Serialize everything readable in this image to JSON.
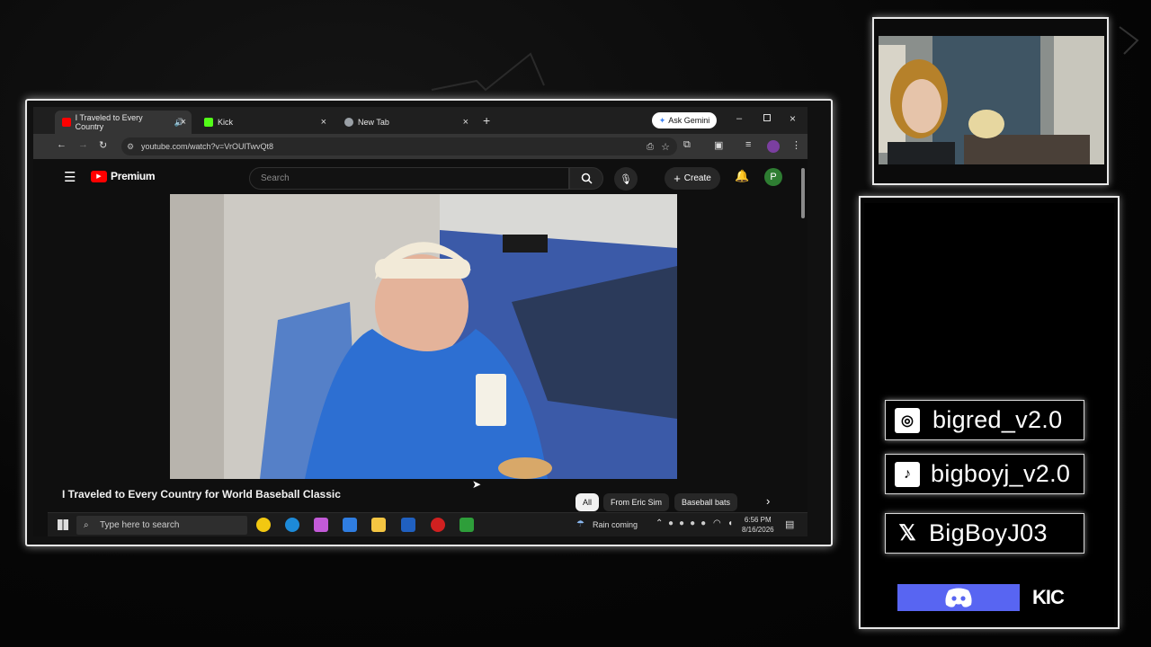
{
  "browser": {
    "tabs": [
      {
        "label": "I Traveled to Every Country",
        "favicon_color": "#ff0000",
        "active": true
      },
      {
        "label": "Kick",
        "favicon_color": "#53fc18",
        "active": false
      },
      {
        "label": "New Tab",
        "favicon_color": "#9aa0a6",
        "active": false
      }
    ],
    "new_tab_symbol": "+",
    "ask_gemini_label": "Ask Gemini",
    "url": "youtube.com/watch?v=VrOUlTwvQt8"
  },
  "youtube": {
    "brand_label": "Premium",
    "search_placeholder": "Search",
    "create_label": "Create",
    "avatar_letter": "P",
    "video_title": "I Traveled to Every Country for World Baseball Classic",
    "chips": [
      "All",
      "From Eric Sim",
      "Baseball bats"
    ],
    "channel_partial": "Eric Sim"
  },
  "taskbar": {
    "search_placeholder": "Type here to search",
    "weather": "Rain coming",
    "time": "6:56 PM",
    "date": "8/16/2026"
  },
  "overlay": {
    "socials": [
      {
        "icon": "instagram-icon",
        "handle": "bigred_v2.0"
      },
      {
        "icon": "tiktok-icon",
        "handle": "bigboyj_v2.0"
      },
      {
        "icon": "x-icon",
        "handle": "BigBoyJ03"
      }
    ],
    "kick_text": "KIC"
  },
  "colors": {
    "youtube_red": "#ff0000",
    "discord_blurple": "#5865f2",
    "avatar_green": "#2e7d32"
  }
}
